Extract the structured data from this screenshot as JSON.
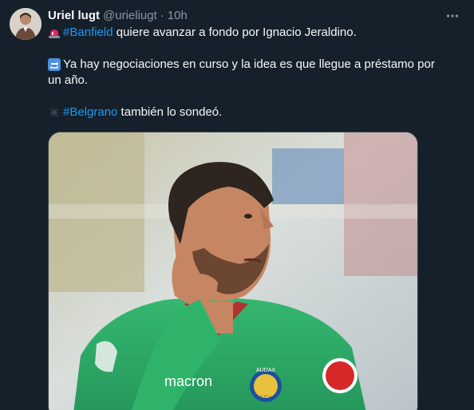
{
  "tweet": {
    "author_name": "Uriel lugt",
    "handle": "@urieliugt",
    "separator": "·",
    "time": "10h",
    "lines": {
      "line1_hashtag": "#Banfield",
      "line1_text": " quiere avanzar a fondo por Ignacio Jeraldino.",
      "line2_text": "Ya hay negociaciones en curso y la idea es que llegue a préstamo por",
      "line3_text": "un año.",
      "line4_hashtag": "#Belgrano",
      "line4_text": " también lo sondeó."
    },
    "icons": {
      "more": "more-dots-icon",
      "emoji1": "siren-emoji",
      "emoji2": "arrows-cycle-emoji",
      "emoji3": "sparkle-emoji"
    },
    "media": {
      "jersey_brand": "macron",
      "badge_text": "AUDAX",
      "badge_letters": "A.C.I."
    }
  },
  "colors": {
    "background": "#15202b",
    "text": "#f7f9f9",
    "secondary": "#8b98a5",
    "link": "#1d9bf0",
    "jersey": "#2fb36a"
  }
}
